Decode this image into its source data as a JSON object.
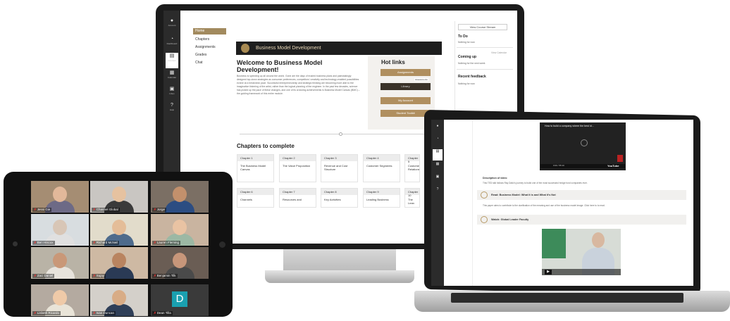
{
  "imac": {
    "nav": [
      {
        "label": "Account",
        "icon": "account-icon"
      },
      {
        "label": "Dashboard",
        "icon": "dashboard-icon"
      },
      {
        "label": "Courses",
        "icon": "courses-icon"
      },
      {
        "label": "Calendar",
        "icon": "calendar-icon"
      },
      {
        "label": "Inbox",
        "icon": "inbox-icon"
      },
      {
        "label": "Help",
        "icon": "help-icon"
      }
    ],
    "menu": [
      "Home",
      "Chapters",
      "Assignments",
      "Grades",
      "Chat"
    ],
    "banner": "Business Model Development",
    "welcome_title": "Welcome to Business Model Development!",
    "welcome_body": "Business is speeding up all around the world. Gone are the days of trusted business plans and painstakingly designed top-down strategies as consumer preferences, competitors' creativity and technology-enabled possibilities evolve at a breakneck pace. Successful entrepreneurship and strategic thinking are becoming more akin to the imaginative tinkering of the artist, rather than the logical planning of the engineer. In the past few decades, science has picked up the pace of these changes, and one of its crowning achievements is Business Model Canvas (BMC) – the guiding framework of this entire module.",
    "hot_links": {
      "title": "Hot links",
      "buttons": [
        "Assignments",
        "Library",
        "My Account",
        "Student Toolkit"
      ],
      "tooltip": "Assessments"
    },
    "chapters_title": "Chapters to complete",
    "chapters": [
      {
        "num": "Chapter 1",
        "title": "The Business Model Canvas"
      },
      {
        "num": "Chapter 2",
        "title": "The Value Proposition"
      },
      {
        "num": "Chapter 3",
        "title": "Revenue and Cost Structure"
      },
      {
        "num": "Chapter 4",
        "title": "Customer Segments"
      },
      {
        "num": "Chapter 5",
        "title": "Customer Relations"
      },
      {
        "num": "Chapter 6",
        "title": "Channels"
      },
      {
        "num": "Chapter 7",
        "title": "Resources and"
      },
      {
        "num": "Chapter 8",
        "title": "Key Activities"
      },
      {
        "num": "Chapter 9",
        "title": "Leading Business"
      },
      {
        "num": "Chapter 10",
        "title": "The Lean"
      }
    ],
    "right": {
      "view_button": "View Course Stream",
      "todo_h": "To Do",
      "todo_t": "Nothing for now",
      "coming_h": "Coming up",
      "coming_link": "View Calendar",
      "coming_t": "Nothing for the next week",
      "feedback_h": "Recent feedback",
      "feedback_t": "Nothing for now"
    }
  },
  "laptop": {
    "video_title": "How to build a company where the best id...",
    "video_time": "0:00 / 55:10",
    "video_brand": "YouTube",
    "desc_h": "Description of video",
    "desc_t": "This TED talk follows Ray Dalio's journey to build one of the most successful hedge fund companies ever.",
    "row1": "Read: Business Model: What it is and What it's Not",
    "text1": "This paper aims to contribute to the clarification of the meaning and use of the business model image. Click here to to read.",
    "row2": "Watch: Global Leader Faculty"
  },
  "tablet": {
    "tiles": [
      {
        "name": "Jessi Gie",
        "face": "#e2b89a",
        "body": "#6d6a86",
        "bg": "#a58d73"
      },
      {
        "name": "Channel Global",
        "face": "#e6c2a0",
        "body": "#3a3a3a",
        "bg": "#c9c6c2"
      },
      {
        "name": "Jorge",
        "face": "#c2906c",
        "body": "#2c4d82",
        "bg": "#7b6f64"
      },
      {
        "name": "Ben Hiscox",
        "face": "#d8c6b6",
        "body": "#e0e0e0",
        "bg": "#d8dde0"
      },
      {
        "name": "Richard McNeil",
        "face": "#e4bd98",
        "body": "#4e6b8c",
        "bg": "#e2dccb"
      },
      {
        "name": "Lauren Fleming",
        "face": "#e9c3a3",
        "body": "#9cb8a4",
        "bg": "#c9b4a0"
      },
      {
        "name": "Zaci Daniel",
        "face": "#c99878",
        "body": "#e7e3dc",
        "bg": "#b9b3a6"
      },
      {
        "name": "Sujay",
        "face": "#b98460",
        "body": "#2a3a55",
        "bg": "#ceb9a3"
      },
      {
        "name": "Benjamin Tilk",
        "face": "#c7967a",
        "body": "#4a4a4a",
        "bg": "#6a5d54"
      },
      {
        "name": "Lisbeth Ricardo",
        "face": "#efcaa8",
        "body": "#e9e4d8",
        "bg": "#b4aaa0"
      },
      {
        "name": "Ivan Duncan",
        "face": "#d8ac86",
        "body": "#2f3f58",
        "bg": "#d4d0ca"
      },
      {
        "name": "Dean Tilla",
        "face": "",
        "body": "",
        "bg": "#3a3a3a",
        "avatar": "D"
      }
    ]
  }
}
